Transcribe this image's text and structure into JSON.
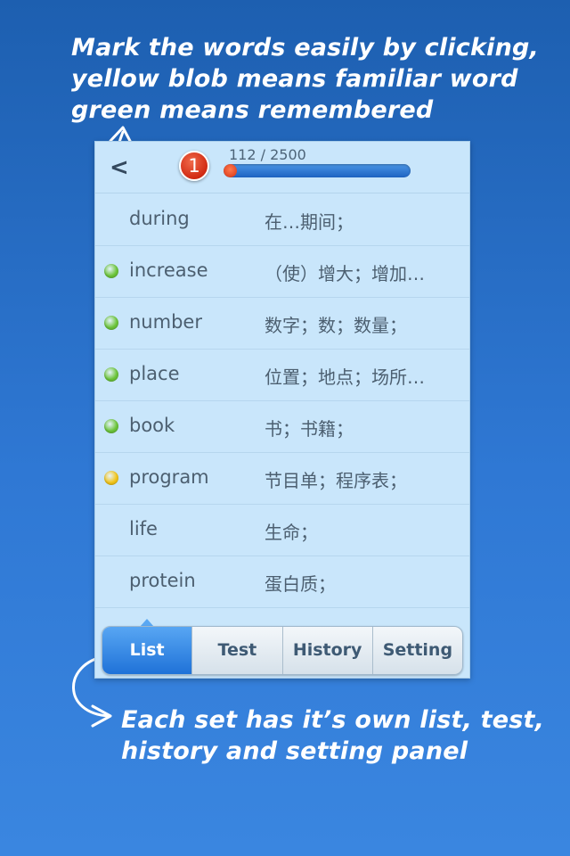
{
  "callouts": {
    "top_lines": [
      "Mark the words easily by clicking,",
      "yellow blob means familiar word",
      "green means remembered"
    ],
    "bottom_lines": [
      "Each set has it’s own list, test,",
      "history and setting panel"
    ]
  },
  "header": {
    "back_glyph": "<",
    "badge": "1",
    "progress_text": "112 / 2500",
    "progress_current": 112,
    "progress_total": 2500
  },
  "colors": {
    "green": "#6cc53a",
    "yellow": "#f2c51a",
    "accent": "#1f72d8"
  },
  "words": [
    {
      "word": "during",
      "meaning": "在…期间；",
      "status": "none"
    },
    {
      "word": "increase",
      "meaning": "（使）增大；增加…",
      "status": "green"
    },
    {
      "word": "number",
      "meaning": "数字；数；数量；",
      "status": "green"
    },
    {
      "word": "place",
      "meaning": "位置；地点；场所…",
      "status": "green"
    },
    {
      "word": "book",
      "meaning": "书；书籍；",
      "status": "green"
    },
    {
      "word": "program",
      "meaning": "节目单；程序表；",
      "status": "yellow"
    },
    {
      "word": "life",
      "meaning": "生命；",
      "status": "none"
    },
    {
      "word": "protein",
      "meaning": "蛋白质；",
      "status": "none"
    }
  ],
  "tabs": [
    {
      "label": "List",
      "active": true
    },
    {
      "label": "Test",
      "active": false
    },
    {
      "label": "History",
      "active": false
    },
    {
      "label": "Setting",
      "active": false
    }
  ]
}
